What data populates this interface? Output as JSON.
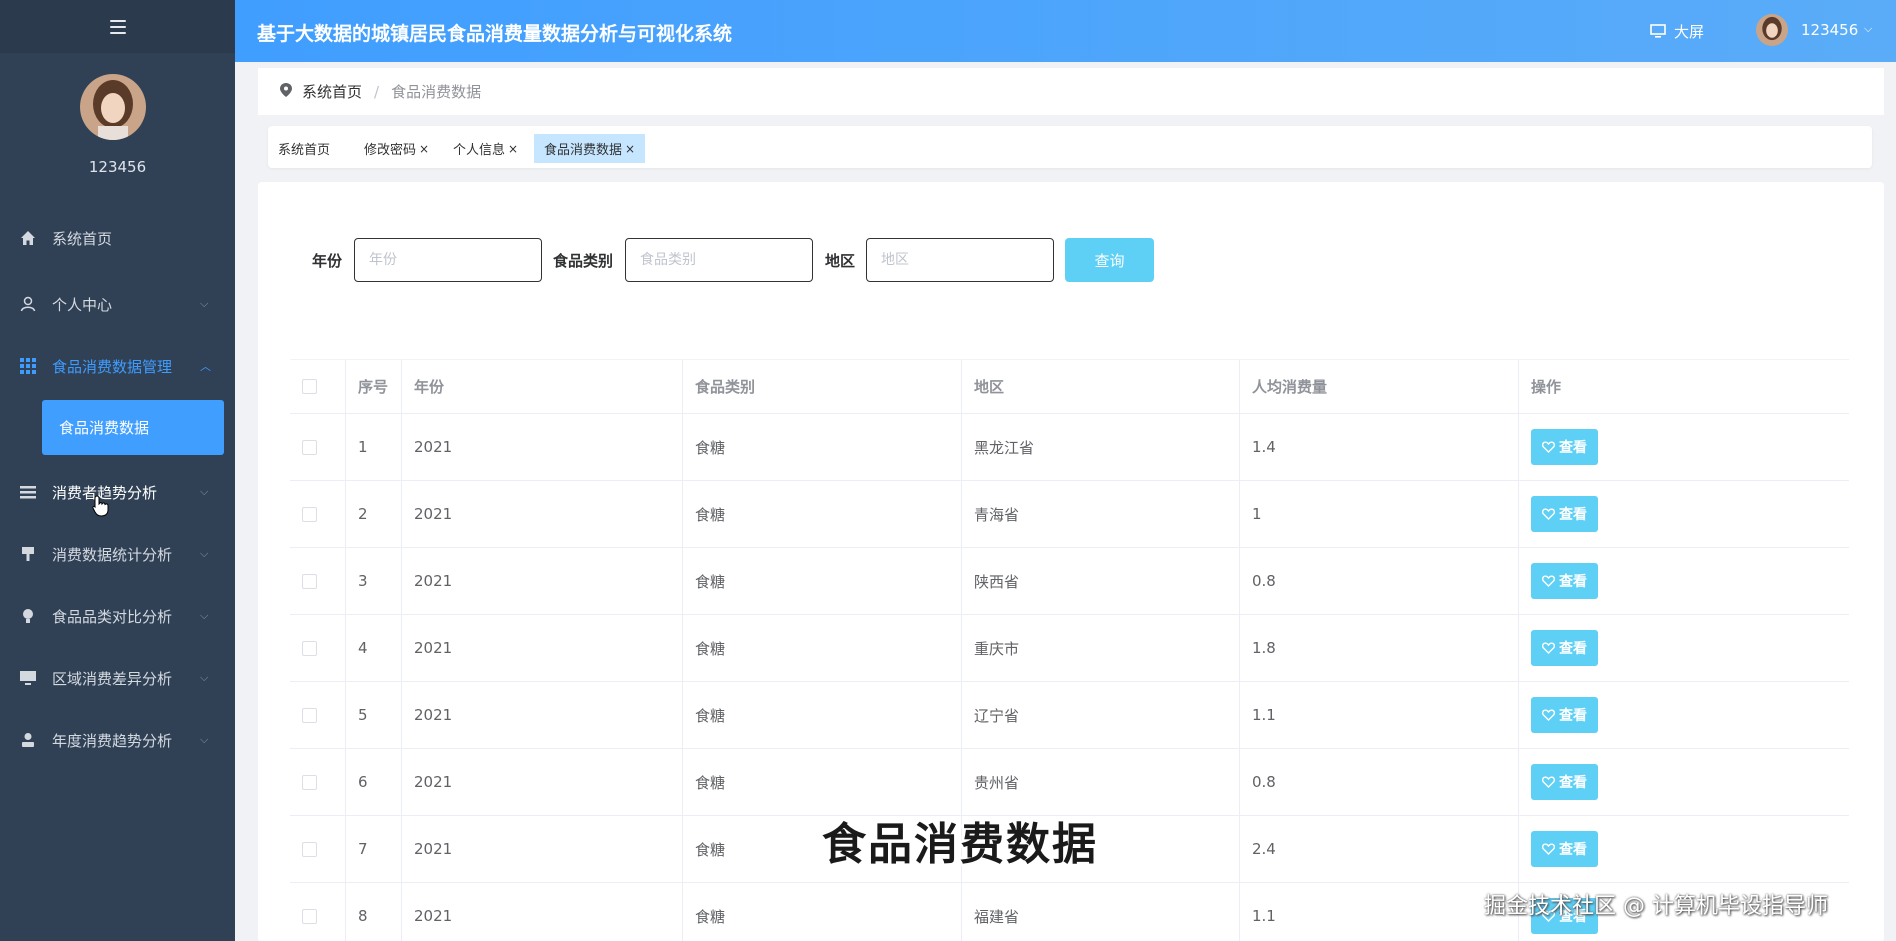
{
  "header": {
    "title": "基于大数据的城镇居民食品消费量数据分析与可视化系统",
    "bigscreen_label": "大屏",
    "username": "123456"
  },
  "sidebar": {
    "username": "123456",
    "items": [
      {
        "label": "系统首页"
      },
      {
        "label": "个人中心"
      },
      {
        "label": "食品消费数据管理"
      },
      {
        "label": "消费者趋势分析"
      },
      {
        "label": "消费数据统计分析"
      },
      {
        "label": "食品品类对比分析"
      },
      {
        "label": "区域消费差异分析"
      },
      {
        "label": "年度消费趋势分析"
      }
    ],
    "subitem": "食品消费数据"
  },
  "breadcrumb": {
    "home": "系统首页",
    "current": "食品消费数据",
    "separator": "/"
  },
  "tags": [
    {
      "label": "系统首页",
      "close": ""
    },
    {
      "label": "修改密码",
      "close": "×"
    },
    {
      "label": "个人信息",
      "close": "×"
    },
    {
      "label": "食品消费数据",
      "close": "×"
    }
  ],
  "filters": {
    "year_label": "年份",
    "year_placeholder": "年份",
    "category_label": "食品类别",
    "category_placeholder": "食品类别",
    "region_label": "地区",
    "region_placeholder": "地区",
    "query_button": "查询"
  },
  "table": {
    "columns": [
      "序号",
      "年份",
      "食品类别",
      "地区",
      "人均消费量",
      "操作"
    ],
    "view_label": "查看",
    "rows": [
      [
        "1",
        "2021",
        "食糖",
        "黑龙江省",
        "1.4"
      ],
      [
        "2",
        "2021",
        "食糖",
        "青海省",
        "1"
      ],
      [
        "3",
        "2021",
        "食糖",
        "陕西省",
        "0.8"
      ],
      [
        "4",
        "2021",
        "食糖",
        "重庆市",
        "1.8"
      ],
      [
        "5",
        "2021",
        "食糖",
        "辽宁省",
        "1.1"
      ],
      [
        "6",
        "2021",
        "食糖",
        "贵州省",
        "0.8"
      ],
      [
        "7",
        "2021",
        "食糖",
        "",
        "2.4"
      ],
      [
        "8",
        "2021",
        "食糖",
        "福建省",
        "1.1"
      ]
    ]
  },
  "overlay": {
    "subtitle": "食品消费数据",
    "watermark": "掘金技术社区 @ 计算机毕设指导师"
  },
  "colors": {
    "sidebar": "#304156",
    "header": "#409eff",
    "accent": "#409eff",
    "button": "#5ecff5"
  }
}
